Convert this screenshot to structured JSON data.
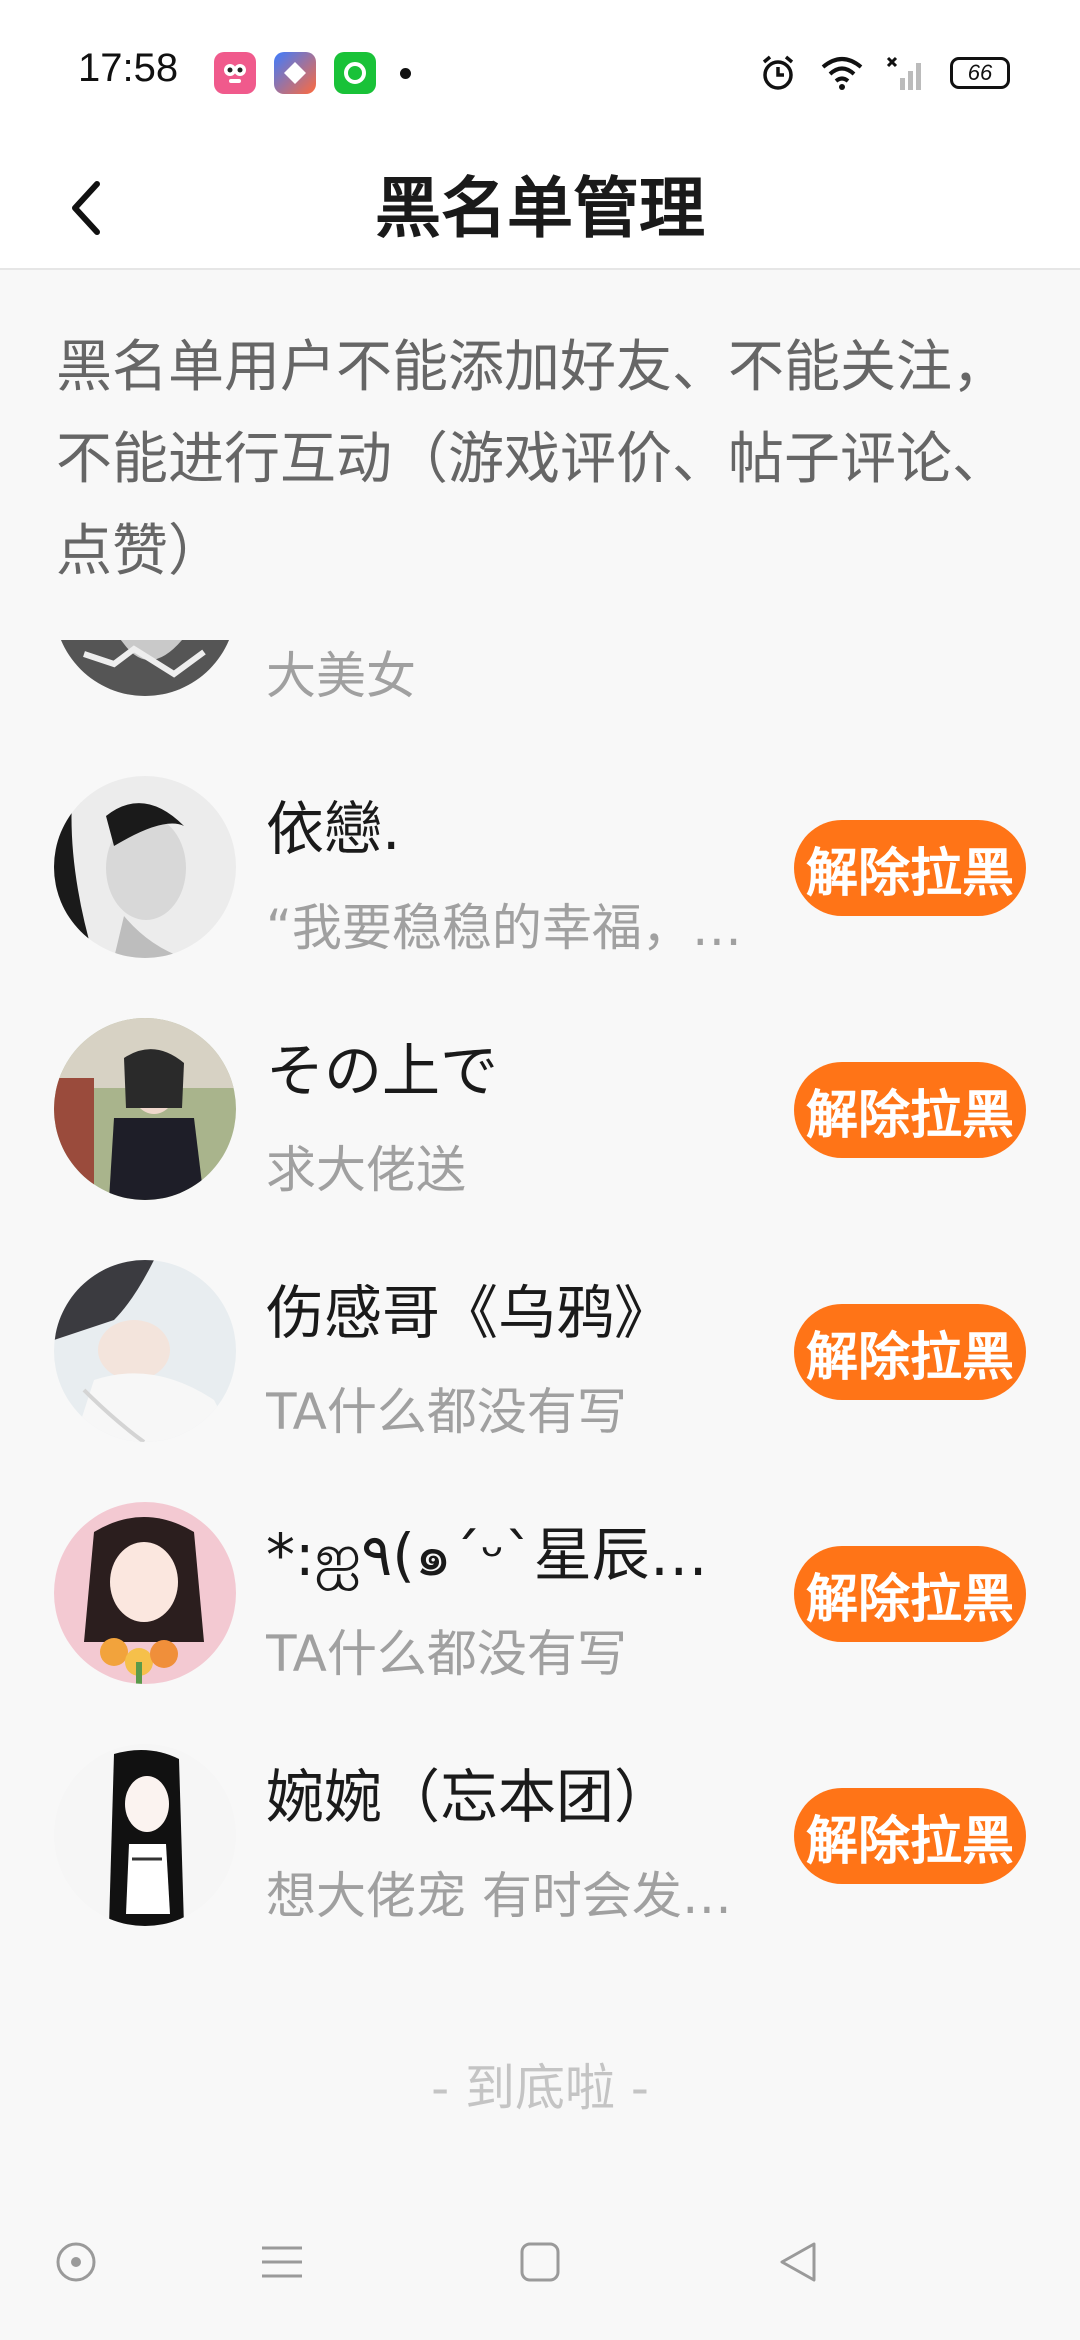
{
  "status_bar": {
    "time": "17:58",
    "battery": "66",
    "notification_icons": [
      "meme-app-icon",
      "shortcut-app-icon",
      "green-app-icon"
    ],
    "status_icons": [
      "alarm-icon",
      "wifi-icon",
      "signal-icon",
      "battery-icon"
    ]
  },
  "header": {
    "title": "黑名单管理",
    "back_icon": "chevron-left-icon"
  },
  "description": "黑名单用户不能添加好友、不能关注，不能进行互动（游戏评价、帖子评论、点赞）",
  "blocked_users": [
    {
      "name": "",
      "bio": "大美女",
      "button": ""
    },
    {
      "name": "依戀.",
      "bio": "“我要稳稳的幸福，…",
      "button": "解除拉黑"
    },
    {
      "name": "その上で",
      "bio": "求大佬送",
      "button": "解除拉黑"
    },
    {
      "name": "伤感哥《乌鸦》",
      "bio": "TA什么都没有写",
      "button": "解除拉黑"
    },
    {
      "name": "*:ஐ٩(๑´ᵕ`星辰…",
      "bio": "TA什么都没有写",
      "button": "解除拉黑"
    },
    {
      "name": "婉婉（忘本团）",
      "bio": "想大佬宠 有时会发…",
      "button": "解除拉黑"
    }
  ],
  "end_text": "- 到底啦 -",
  "colors": {
    "accent": "#ff7417",
    "background": "#f8f8f8",
    "secondary_text": "#a0a0a0"
  },
  "nav_bar": [
    "assistant-icon",
    "menu-icon",
    "home-square-icon",
    "back-triangle-icon"
  ]
}
